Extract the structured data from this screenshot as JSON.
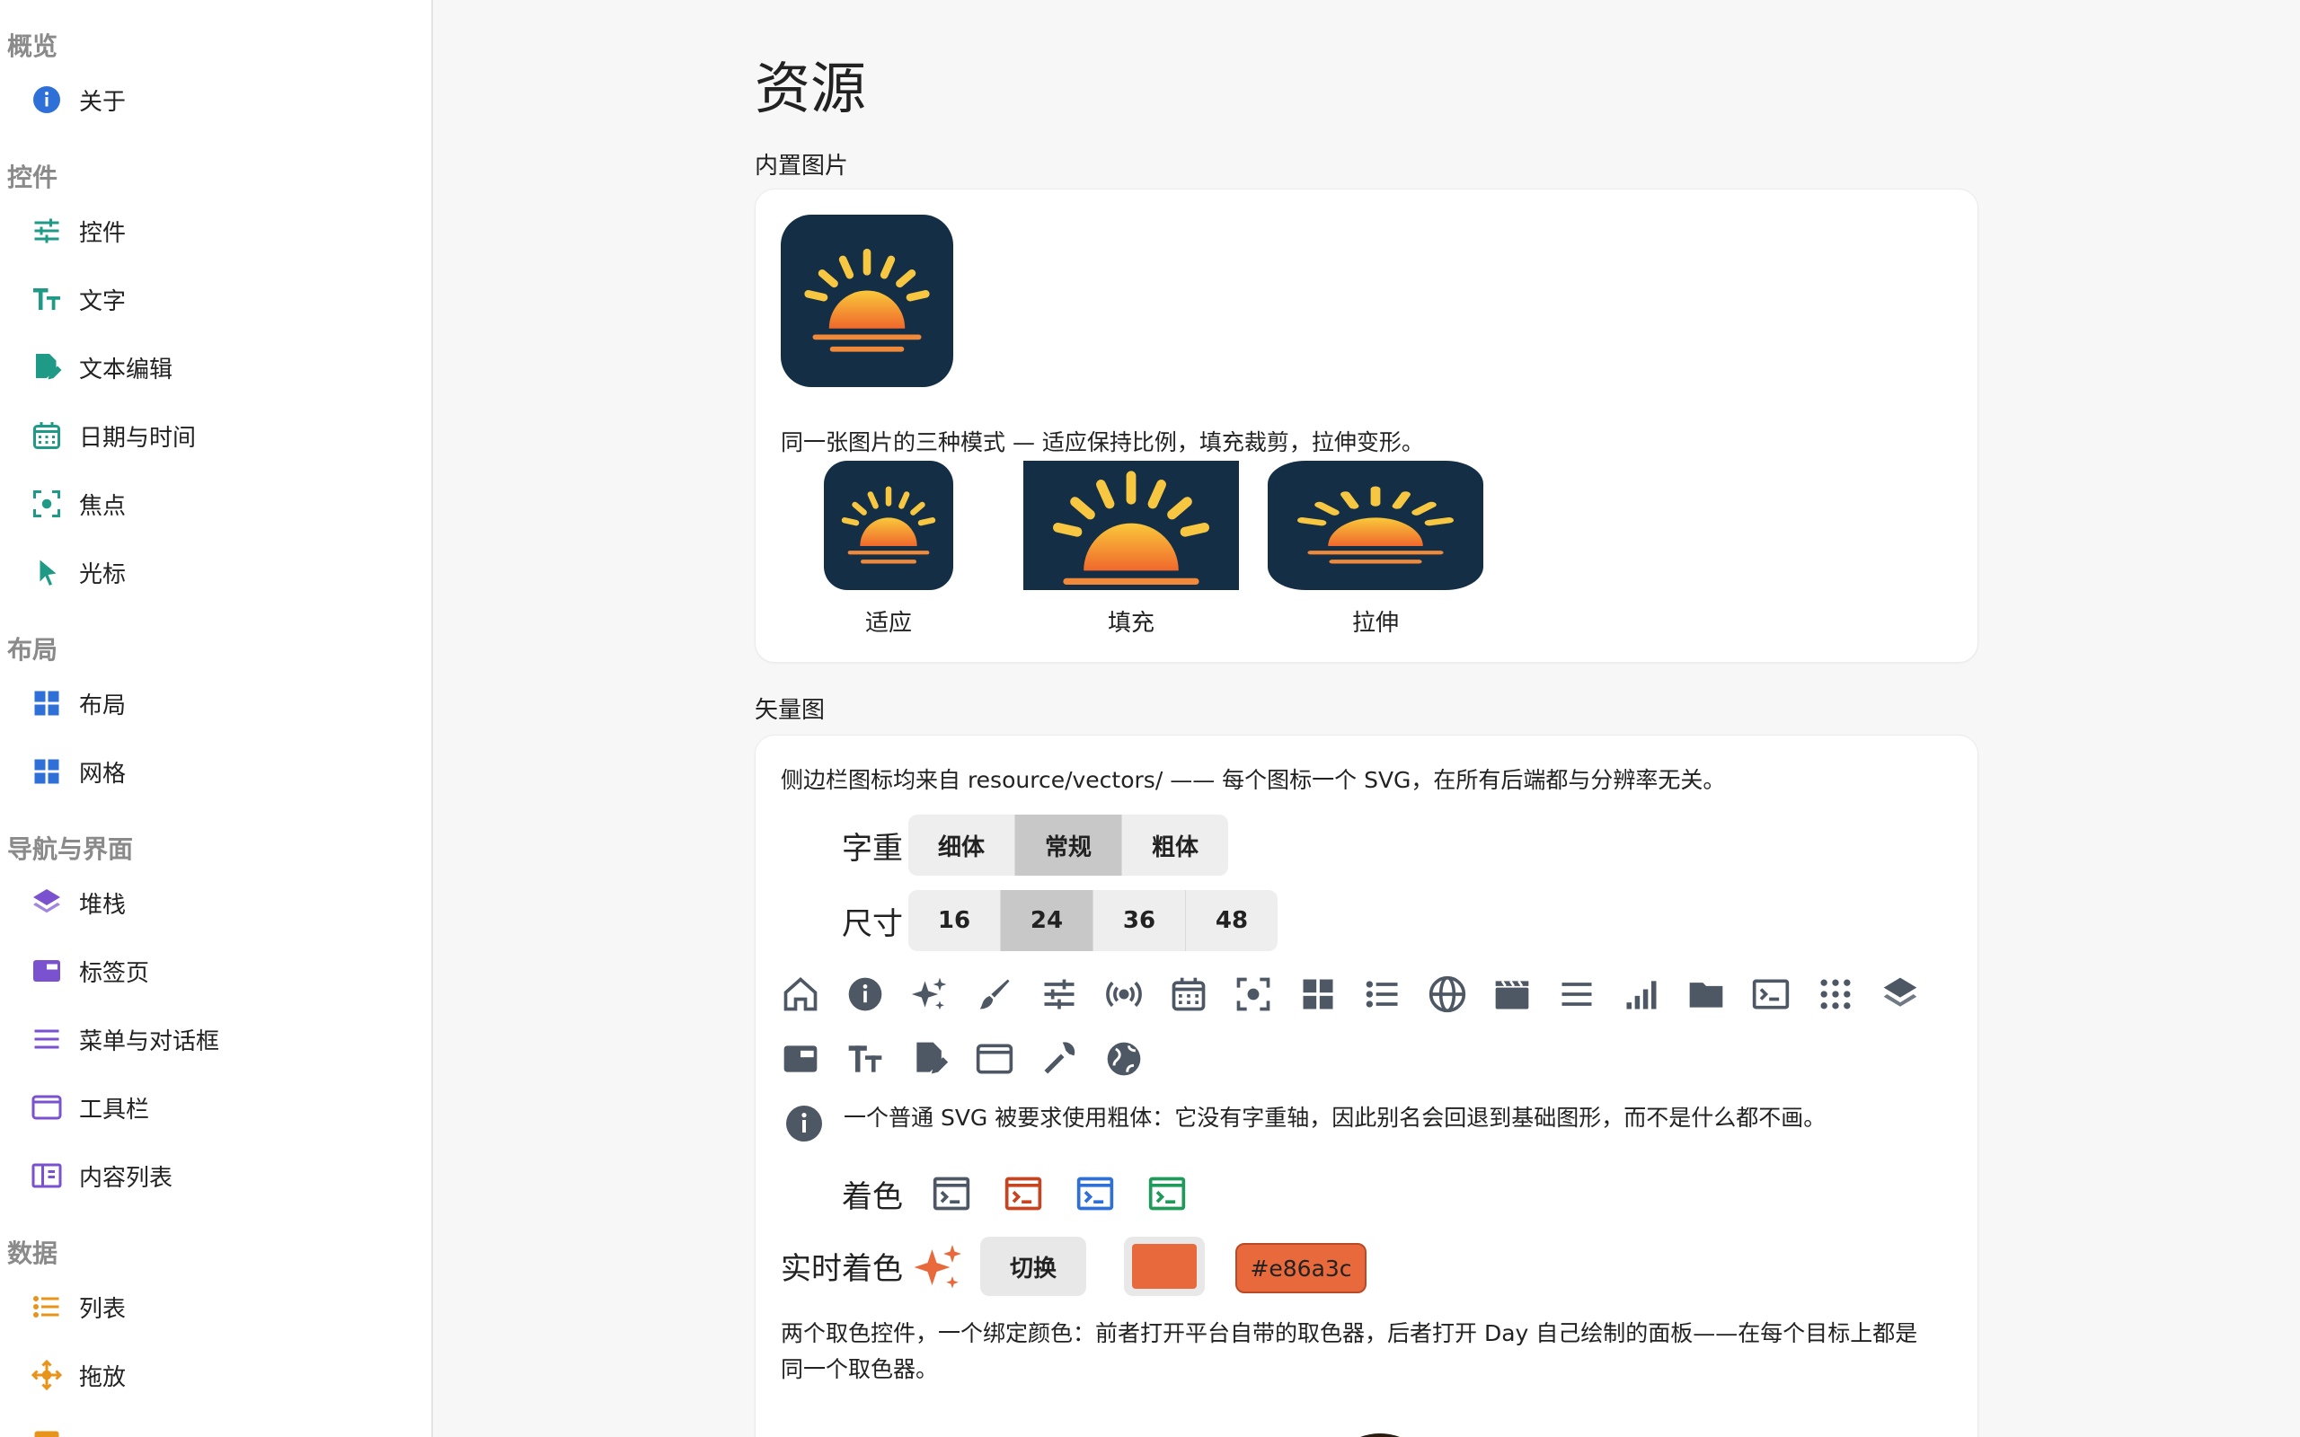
{
  "sidebar": {
    "sections": [
      {
        "title": "概览",
        "items": [
          {
            "label": "关于",
            "icon": "info-icon",
            "color": "#2e6fd8"
          }
        ]
      },
      {
        "title": "控件",
        "items": [
          {
            "label": "控件",
            "icon": "sliders-icon",
            "color": "#1f9a86"
          },
          {
            "label": "文字",
            "icon": "text-size-icon",
            "color": "#1f9a86"
          },
          {
            "label": "文本编辑",
            "icon": "document-edit-icon",
            "color": "#1f9a86"
          },
          {
            "label": "日期与时间",
            "icon": "calendar-icon",
            "color": "#1f9a86"
          },
          {
            "label": "焦点",
            "icon": "focus-icon",
            "color": "#1f9a86"
          },
          {
            "label": "光标",
            "icon": "cursor-icon",
            "color": "#1f9a86"
          }
        ]
      },
      {
        "title": "布局",
        "items": [
          {
            "label": "布局",
            "icon": "layout-grid-icon",
            "color": "#2e6fd8"
          },
          {
            "label": "网格",
            "icon": "grid-icon",
            "color": "#2e6fd8"
          }
        ]
      },
      {
        "title": "导航与界面",
        "items": [
          {
            "label": "堆栈",
            "icon": "layers-icon",
            "color": "#7a52d0"
          },
          {
            "label": "标签页",
            "icon": "tabs-icon",
            "color": "#7a52d0"
          },
          {
            "label": "菜单与对话框",
            "icon": "menu-icon",
            "color": "#7a52d0"
          },
          {
            "label": "工具栏",
            "icon": "window-icon",
            "color": "#7a52d0"
          },
          {
            "label": "内容列表",
            "icon": "book-icon",
            "color": "#7a52d0"
          }
        ]
      },
      {
        "title": "数据",
        "items": [
          {
            "label": "列表",
            "icon": "list-icon",
            "color": "#e8931a"
          },
          {
            "label": "拖放",
            "icon": "move-icon",
            "color": "#e8931a"
          },
          {
            "label": "…",
            "icon": "table-icon",
            "color": "#e8931a"
          }
        ]
      }
    ]
  },
  "main": {
    "title": "资源",
    "builtin": {
      "header": "内置图片",
      "caption": "同一张图片的三种模式 — 适应保持比例，填充裁剪，拉伸变形。",
      "modes": [
        "适应",
        "填充",
        "拉伸"
      ]
    },
    "vectors": {
      "header": "矢量图",
      "description": "侧边栏图标均来自 resource/vectors/ —— 每个图标一个 SVG，在所有后端都与分辨率无关。",
      "weight_label": "字重",
      "weights": [
        "细体",
        "常规",
        "粗体"
      ],
      "weight_selected": "常规",
      "size_label": "尺寸",
      "sizes": [
        "16",
        "24",
        "36",
        "48"
      ],
      "size_selected": "24",
      "icons": [
        "home-icon",
        "info-icon",
        "sparkle-icon",
        "brush-icon",
        "sliders-icon",
        "broadcast-icon",
        "calendar-icon",
        "focus-icon",
        "grid-icon",
        "list-icon",
        "globe-icon",
        "clapperboard-icon",
        "menu-icon",
        "bar-chart-icon",
        "folder-icon",
        "terminal-icon",
        "apps-icon",
        "layers-icon",
        "tabs-icon",
        "text-size-icon",
        "document-edit-icon",
        "window-icon",
        "wrench-icon",
        "globe-filled-icon"
      ],
      "note": "一个普通 SVG 被要求使用粗体：它没有字重轴，因此别名会回退到基础图形，而不是什么都不画。",
      "tint_label": "着色",
      "tint_colors": [
        "#4e5865",
        "#c8431f",
        "#2e6fd8",
        "#1f9a5a"
      ],
      "live_tint_label": "实时着色",
      "toggle_label": "切换",
      "live_color": "#e86a3c",
      "live_color_text": "#e86a3c",
      "footer": "两个取色控件，一个绑定颜色：前者打开平台自带的取色器，后者打开 Day 自己绘制的面板——在每个目标上都是同一个取色器。"
    }
  }
}
